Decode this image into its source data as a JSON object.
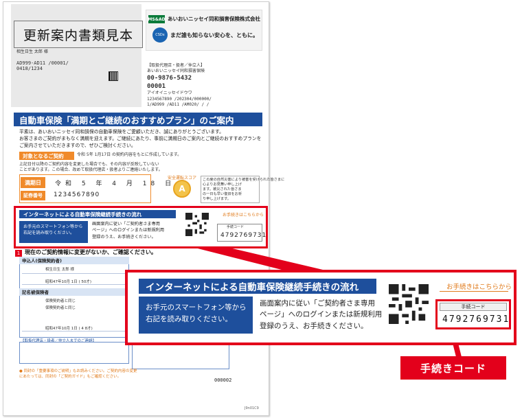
{
  "sample_label": "更新案内書類見本",
  "addressee": {
    "name": "相生日生 太郎 様",
    "code1": "AD999-AD11 /00001/",
    "code2": "0418/1234"
  },
  "brand": {
    "small_tag": "MS&AD",
    "company": "あいおいニッセイ同和損害保険株式会社",
    "slogan": "まだ誰も知らない安心を、ともに。",
    "logo_text": "CSDx"
  },
  "agent_info": {
    "lines": [
      "【取扱代理店・扱者／仲立人】",
      "あいおいニッセイ同和損害保険",
      "00-9876-5432",
      "00001",
      "アイオイニッセイドウワ",
      "1234567890 /202304/000000/",
      "1/AD999 /AD11 /AM020/ / /"
    ]
  },
  "main_title": "自動車保険「満期とご継続のおすすめプラン」のご案内",
  "intro": [
    "平素は、あいおいニッセイ同和損保の自動車保険をご愛顧いただき、誠にありがとうございます。",
    "お客さまのご契約がまもなく満期を迎えます。ご継続にあたり、事前に満期日のご案内とご継続のおすすめプランを",
    "ご案内させていただきますので、ぜひご検討ください。"
  ],
  "contract_section": {
    "heading": "対象となるご契約",
    "note": "令和 5年 1月17日 の契約内容をもとに作成しています。",
    "sub": [
      "上記日付以降のご契約内容を変更した場合でも、その内容が反映していない",
      "ことがあります。この場合、改めて取扱代理店・扱者よりご連絡いたします。"
    ],
    "expiry_label": "満期日",
    "expiry_value": "令和 5 年 4 月 18 日",
    "policy_label": "証券番号",
    "policy_value": "1234567890"
  },
  "safety_score": {
    "label": "安全運転スコア",
    "grade": "A"
  },
  "side_note": [
    "この度の自然災害により被害を受けられた皆さまに",
    "心よりお見舞い申し上げ",
    "ます。被災された皆さま",
    "の一日も早い復旧をお祈",
    "り申し上げます。"
  ],
  "internet_small": {
    "heading": "インターネットによる自動車保険継続手続きの流れ",
    "left": [
      "お手元のスマートフォン等から",
      "右記を読み取りください。"
    ],
    "mid": [
      "画面案内に従い「ご契約者さま専用",
      "ページ」へのログインまたは新規利用",
      "登録のうえ、お手続きください。"
    ],
    "orange": "お手続きはこちらから",
    "code_label": "手続コード",
    "code_value": "4792769731"
  },
  "section1": {
    "num": "1",
    "title": "現在のご契約情報に変更がないか、ご確認ください。",
    "applicant_head": "申込人(保険契約者)",
    "applicant_lines": [
      "相生日生 太郎 様",
      "昭和47年10月 1日 ( 50才)"
    ],
    "driver_head": "記名被保険者",
    "driver_lines": [
      "保険契約者と同じ",
      "保険契約者と同じ",
      "昭和47年10月 1日 ( 4 8才)"
    ],
    "agent_head": "【取扱代理店・扱者／仲立人までのご連絡】",
    "footnote": [
      "● 同封の「重要事項のご説明」もお読みください。ご契約内容の変更",
      "にあたっては、同封の「ご契約ガイド」もご確認ください。"
    ],
    "page_no": "000002",
    "doc_id": "J9n01C9"
  },
  "internet_big": {
    "heading": "インターネットによる自動車保険継続手続きの流れ",
    "left": [
      "お手元のスマートフォン等から",
      "右記を読み取りください。"
    ],
    "mid": [
      "画面案内に従い「ご契約者さま専用",
      "ページ」へのログインまたは新規利用",
      "登録のうえ、お手続きください。"
    ],
    "orange": "お手続きはこちらから",
    "code_label": "手続コード",
    "code_value": "4792769731"
  },
  "callout": "手続きコード",
  "colors": {
    "brand_blue": "#1e4f9c",
    "accent_orange": "#f08a2a",
    "highlight_red": "#e3001b"
  }
}
